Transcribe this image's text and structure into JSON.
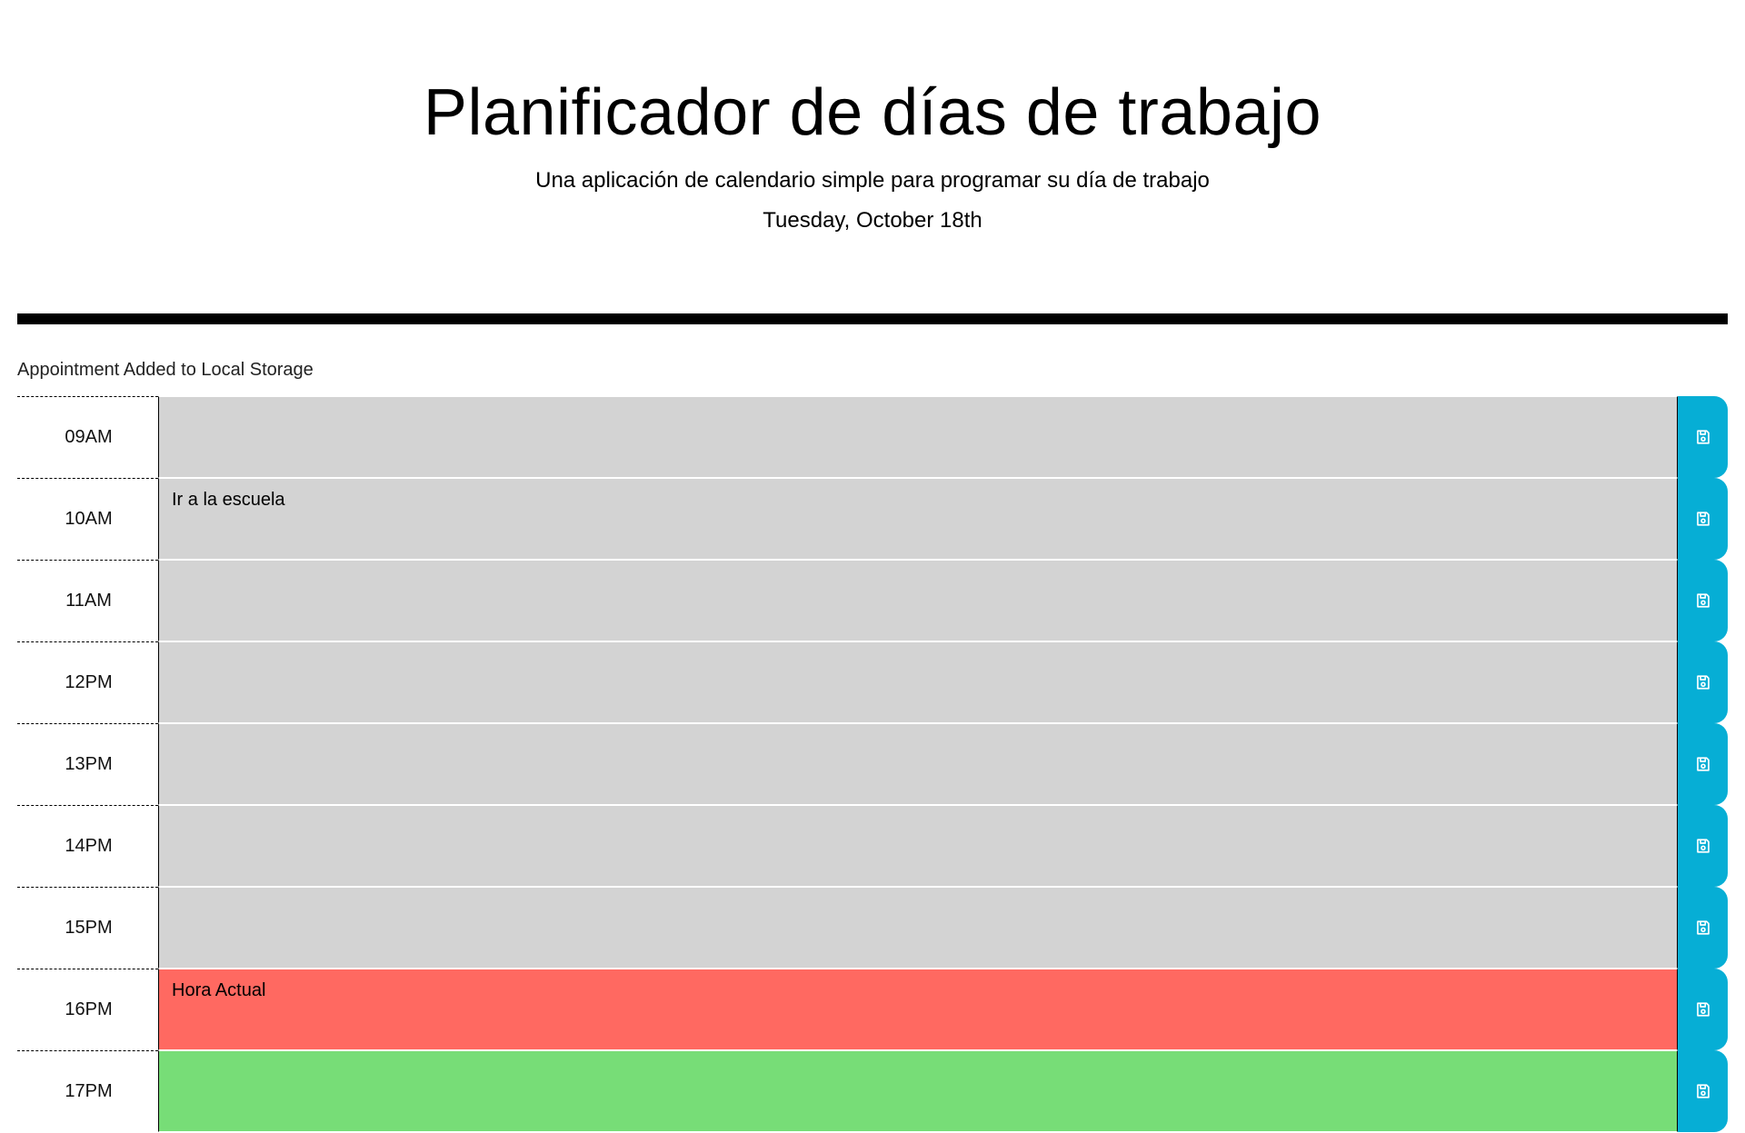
{
  "header": {
    "title": "Planificador de días de trabajo",
    "subtitle": "Una aplicación de calendario simple para programar su día de trabajo",
    "current_day": "Tuesday, October 18th"
  },
  "notice": "Appointment Added to Local Storage",
  "colors": {
    "past": "#d3d3d3",
    "present": "#ff6961",
    "future": "#77dd77",
    "save_button": "#06aed5"
  },
  "save_icon": "floppy-disk-icon",
  "time_blocks": [
    {
      "hour": "09AM",
      "text": "",
      "state": "past"
    },
    {
      "hour": "10AM",
      "text": "Ir a la escuela",
      "state": "past"
    },
    {
      "hour": "11AM",
      "text": "",
      "state": "past"
    },
    {
      "hour": "12PM",
      "text": "",
      "state": "past"
    },
    {
      "hour": "13PM",
      "text": "",
      "state": "past"
    },
    {
      "hour": "14PM",
      "text": "",
      "state": "past"
    },
    {
      "hour": "15PM",
      "text": "",
      "state": "past"
    },
    {
      "hour": "16PM",
      "text": "Hora Actual",
      "state": "present"
    },
    {
      "hour": "17PM",
      "text": "",
      "state": "future"
    }
  ]
}
